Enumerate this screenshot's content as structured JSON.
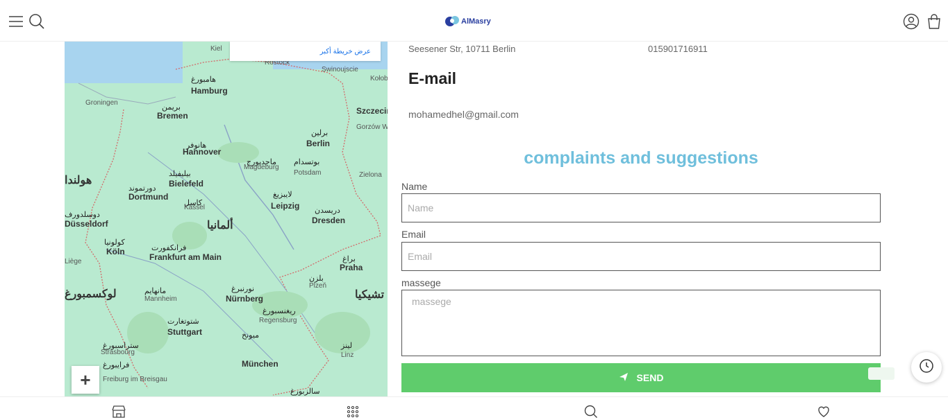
{
  "header": {
    "menu_icon": "hamburger-icon",
    "search_icon": "search-icon",
    "logo_text": "AlMasry",
    "account_icon": "user-icon",
    "cart_icon": "shopping-bag-icon"
  },
  "map": {
    "larger_map_link": "عرض خريطة أكبر",
    "zoom_in": "+",
    "labels": [
      {
        "text": "Kiel",
        "cls": "sm"
      },
      {
        "text": "هامبورغ",
        "cls": "ar"
      },
      {
        "text": "Hamburg",
        "cls": "big"
      },
      {
        "text": "Rostock",
        "cls": "sm"
      },
      {
        "text": "Swinoujscie",
        "cls": "sm"
      },
      {
        "text": "Szczecin",
        "cls": "big"
      },
      {
        "text": "Groningen",
        "cls": "sm"
      },
      {
        "text": "بريمن",
        "cls": "ar"
      },
      {
        "text": "Bremen",
        "cls": "big"
      },
      {
        "text": "برلين",
        "cls": "ar"
      },
      {
        "text": "Berlin",
        "cls": "big"
      },
      {
        "text": "هانوفر",
        "cls": "ar"
      },
      {
        "text": "Hannover",
        "cls": "big"
      },
      {
        "text": "ماجدبورج",
        "cls": "ar"
      },
      {
        "text": "Magdeburg",
        "cls": "sm"
      },
      {
        "text": "بوتسدام",
        "cls": "ar"
      },
      {
        "text": "Potsdam",
        "cls": "sm"
      },
      {
        "text": "هولندا",
        "cls": "country"
      },
      {
        "text": "بيليفيلد",
        "cls": "ar"
      },
      {
        "text": "Bielefeld",
        "cls": "big"
      },
      {
        "text": "دورتموند",
        "cls": "ar"
      },
      {
        "text": "Dortmund",
        "cls": "big"
      },
      {
        "text": "كاسل",
        "cls": "ar"
      },
      {
        "text": "Kassel",
        "cls": "sm"
      },
      {
        "text": "لايبزيغ",
        "cls": "ar"
      },
      {
        "text": "Leipzig",
        "cls": "big"
      },
      {
        "text": "دريسدن",
        "cls": "ar"
      },
      {
        "text": "Dresden",
        "cls": "big"
      },
      {
        "text": "ألمانيا",
        "cls": "country"
      },
      {
        "text": "دوسلدورف",
        "cls": "ar"
      },
      {
        "text": "Düsseldorf",
        "cls": "big"
      },
      {
        "text": "كولونيا",
        "cls": "ar"
      },
      {
        "text": "Köln",
        "cls": "big"
      },
      {
        "text": "فرانكفورت",
        "cls": "ar"
      },
      {
        "text": "Frankfurt am Main",
        "cls": "big"
      },
      {
        "text": "براغ",
        "cls": "ar"
      },
      {
        "text": "Praha",
        "cls": "big"
      },
      {
        "text": "لوكسمبورغ",
        "cls": "country"
      },
      {
        "text": "مانهايم",
        "cls": "ar"
      },
      {
        "text": "Mannheim",
        "cls": "sm"
      },
      {
        "text": "نورنبرغ",
        "cls": "ar"
      },
      {
        "text": "Nürnberg",
        "cls": "big"
      },
      {
        "text": "بلزن",
        "cls": "ar"
      },
      {
        "text": "Plzeň",
        "cls": "sm"
      },
      {
        "text": "تشيكيا",
        "cls": "country"
      },
      {
        "text": "ريغنسبورغ",
        "cls": "ar"
      },
      {
        "text": "Regensburg",
        "cls": "sm"
      },
      {
        "text": "شتوتغارت",
        "cls": "ar"
      },
      {
        "text": "Stuttgart",
        "cls": "big"
      },
      {
        "text": "ستراسبورغ",
        "cls": "ar"
      },
      {
        "text": "Strasbourg",
        "cls": "sm"
      },
      {
        "text": "ميونخ",
        "cls": "ar"
      },
      {
        "text": "München",
        "cls": "big"
      },
      {
        "text": "لينز",
        "cls": "ar"
      },
      {
        "text": "Linz",
        "cls": "sm"
      },
      {
        "text": "فرايبورغ",
        "cls": "ar"
      },
      {
        "text": "Freiburg im Breisgau",
        "cls": "sm"
      },
      {
        "text": "سالزبورغ",
        "cls": "ar"
      },
      {
        "text": "Liège",
        "cls": "sm"
      },
      {
        "text": "Zielona",
        "cls": "sm"
      },
      {
        "text": "Gorzów Wielkopolski",
        "cls": "sm"
      },
      {
        "text": "Kołobrzeg",
        "cls": "sm"
      }
    ]
  },
  "contact": {
    "address": "Seesener Str, 10711 Berlin",
    "phone": "015901716911",
    "email_heading": "E-mail",
    "email_value": "mohamedhel@gmail.com"
  },
  "form": {
    "title": "complaints and suggestions",
    "name_label": "Name",
    "name_placeholder": "Name",
    "email_label": "Email",
    "email_placeholder": "Email",
    "message_label": "massege",
    "message_placeholder": "massege",
    "send_label": "SEND",
    "send_icon": "paper-plane-icon"
  },
  "floating": {
    "history_icon": "history-icon"
  },
  "bottom_nav": {
    "shop_icon": "store-icon",
    "categories_icon": "grid-icon",
    "search_icon": "search-icon",
    "wishlist_icon": "heart-icon"
  },
  "colors": {
    "accent_title": "#6fbfdc",
    "send_button": "#5fcc6c",
    "logo_blue": "#2a3fa0",
    "map_land": "#b9ead0",
    "map_sea": "#a8d4ef"
  }
}
